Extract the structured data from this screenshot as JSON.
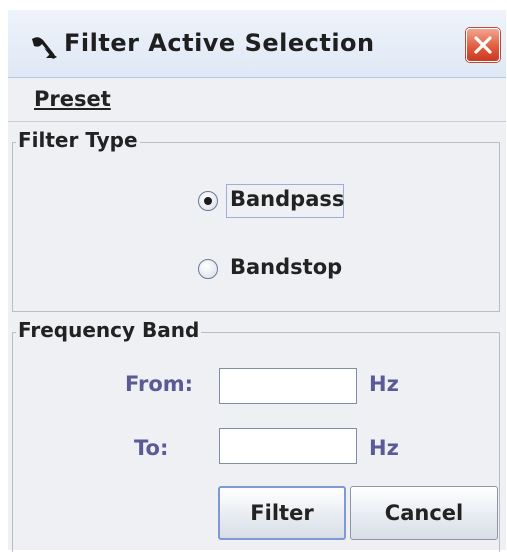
{
  "window": {
    "title": "Filter Active Selection",
    "icon": "app-logo-icon",
    "close_icon": "close-icon"
  },
  "menu": {
    "preset_label": "Preset"
  },
  "filter_type": {
    "title": "Filter Type",
    "options": [
      {
        "label": "Bandpass",
        "selected": true
      },
      {
        "label": "Bandstop",
        "selected": false
      }
    ]
  },
  "frequency_band": {
    "title": "Frequency Band",
    "from_label": "From:",
    "from_value": "",
    "from_unit": "Hz",
    "to_label": "To:",
    "to_value": "",
    "to_unit": "Hz"
  },
  "buttons": {
    "filter": "Filter",
    "cancel": "Cancel"
  },
  "colors": {
    "field_label": "#5a5a96",
    "close_button": "#e0573a"
  }
}
